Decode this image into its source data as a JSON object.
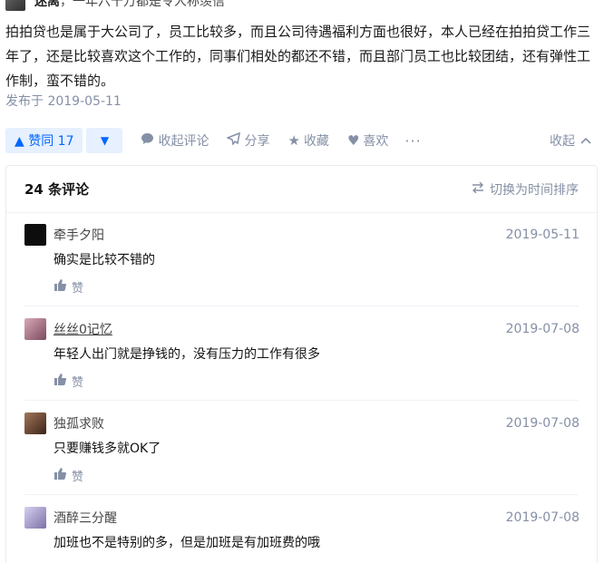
{
  "author": {
    "name": "迷离",
    "bio": "一年六十万都是令人称羡信"
  },
  "answer": {
    "text": "拍拍贷也是属于大公司了，员工比较多，而且公司待遇福利方面也很好，本人已经在拍拍贷工作三年了，还是比较喜欢这个工作的，同事们相处的都还不错，而且部门员工也比较团结，还有弹性工作制，蛮不错的。",
    "date": "发布于 2019-05-11"
  },
  "actions": {
    "vote_up": "▲ 赞同 17",
    "vote_down": "▼",
    "collapse_comments": "收起评论",
    "share": "分享",
    "favorite": "收藏",
    "like": "喜欢",
    "more": "···",
    "collapse": "收起"
  },
  "comments": {
    "title": "24 条评论",
    "sort_toggle": "切换为时间排序",
    "like_label": "赞",
    "items": [
      {
        "name": "牵手夕阳",
        "date": "2019-05-11",
        "text": "确实是比较不错的",
        "avatar_color": "#0d0d0d"
      },
      {
        "name": "丝丝0记忆",
        "date": "2019-07-08",
        "text": "年轻人出门就是挣钱的，没有压力的工作有很多",
        "avatar_color": "#b07a8e"
      },
      {
        "name": "独孤求败",
        "date": "2019-07-08",
        "text": "只要赚钱多就OK了",
        "avatar_color": "#6e4a36"
      },
      {
        "name": "酒醉三分醒",
        "date": "2019-07-08",
        "text": "加班也不是特别的多，但是加班是有加班费的哦",
        "avatar_color": "#a39bc8"
      }
    ]
  }
}
